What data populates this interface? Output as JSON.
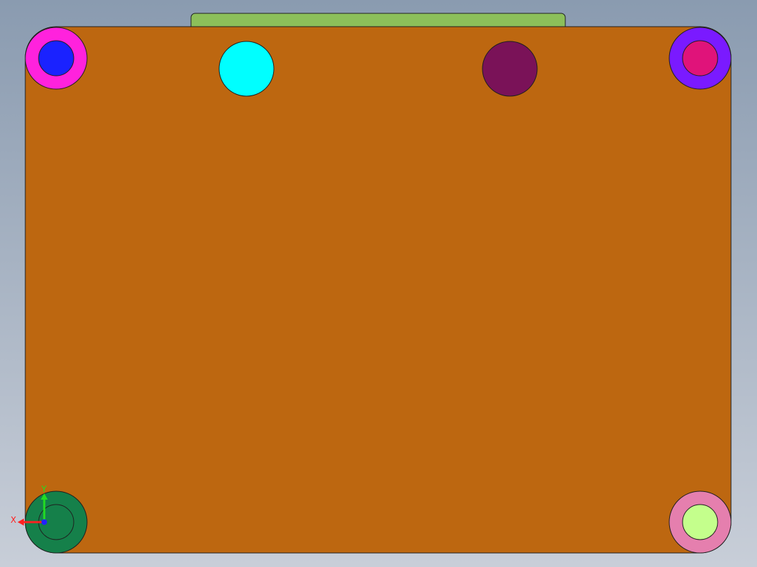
{
  "viewport": {
    "background_top": "#8a9bb0",
    "background_bottom": "#c8ced8"
  },
  "model": {
    "plate_color": "#bd6710",
    "top_bar_color": "#8cbf5a",
    "edge_color": "#1f1f1f",
    "holes": {
      "top_left": {
        "outer": "#ff22dd",
        "inner": "#1a22ff"
      },
      "top_center_left": {
        "fill": "#00ffff"
      },
      "top_center_right": {
        "fill": "#7a1258"
      },
      "top_right": {
        "outer": "#7a1aff",
        "inner": "#e0137a"
      },
      "bottom_left": {
        "outer": "#15804a",
        "inner": "#15804a"
      },
      "bottom_right": {
        "outer": "#e57fae",
        "inner": "#c4ff8c"
      }
    }
  },
  "triad": {
    "x_label": "X",
    "y_label": "Y",
    "x_color": "#ff2020",
    "y_color": "#22dd22",
    "z_color": "#2222ff"
  }
}
